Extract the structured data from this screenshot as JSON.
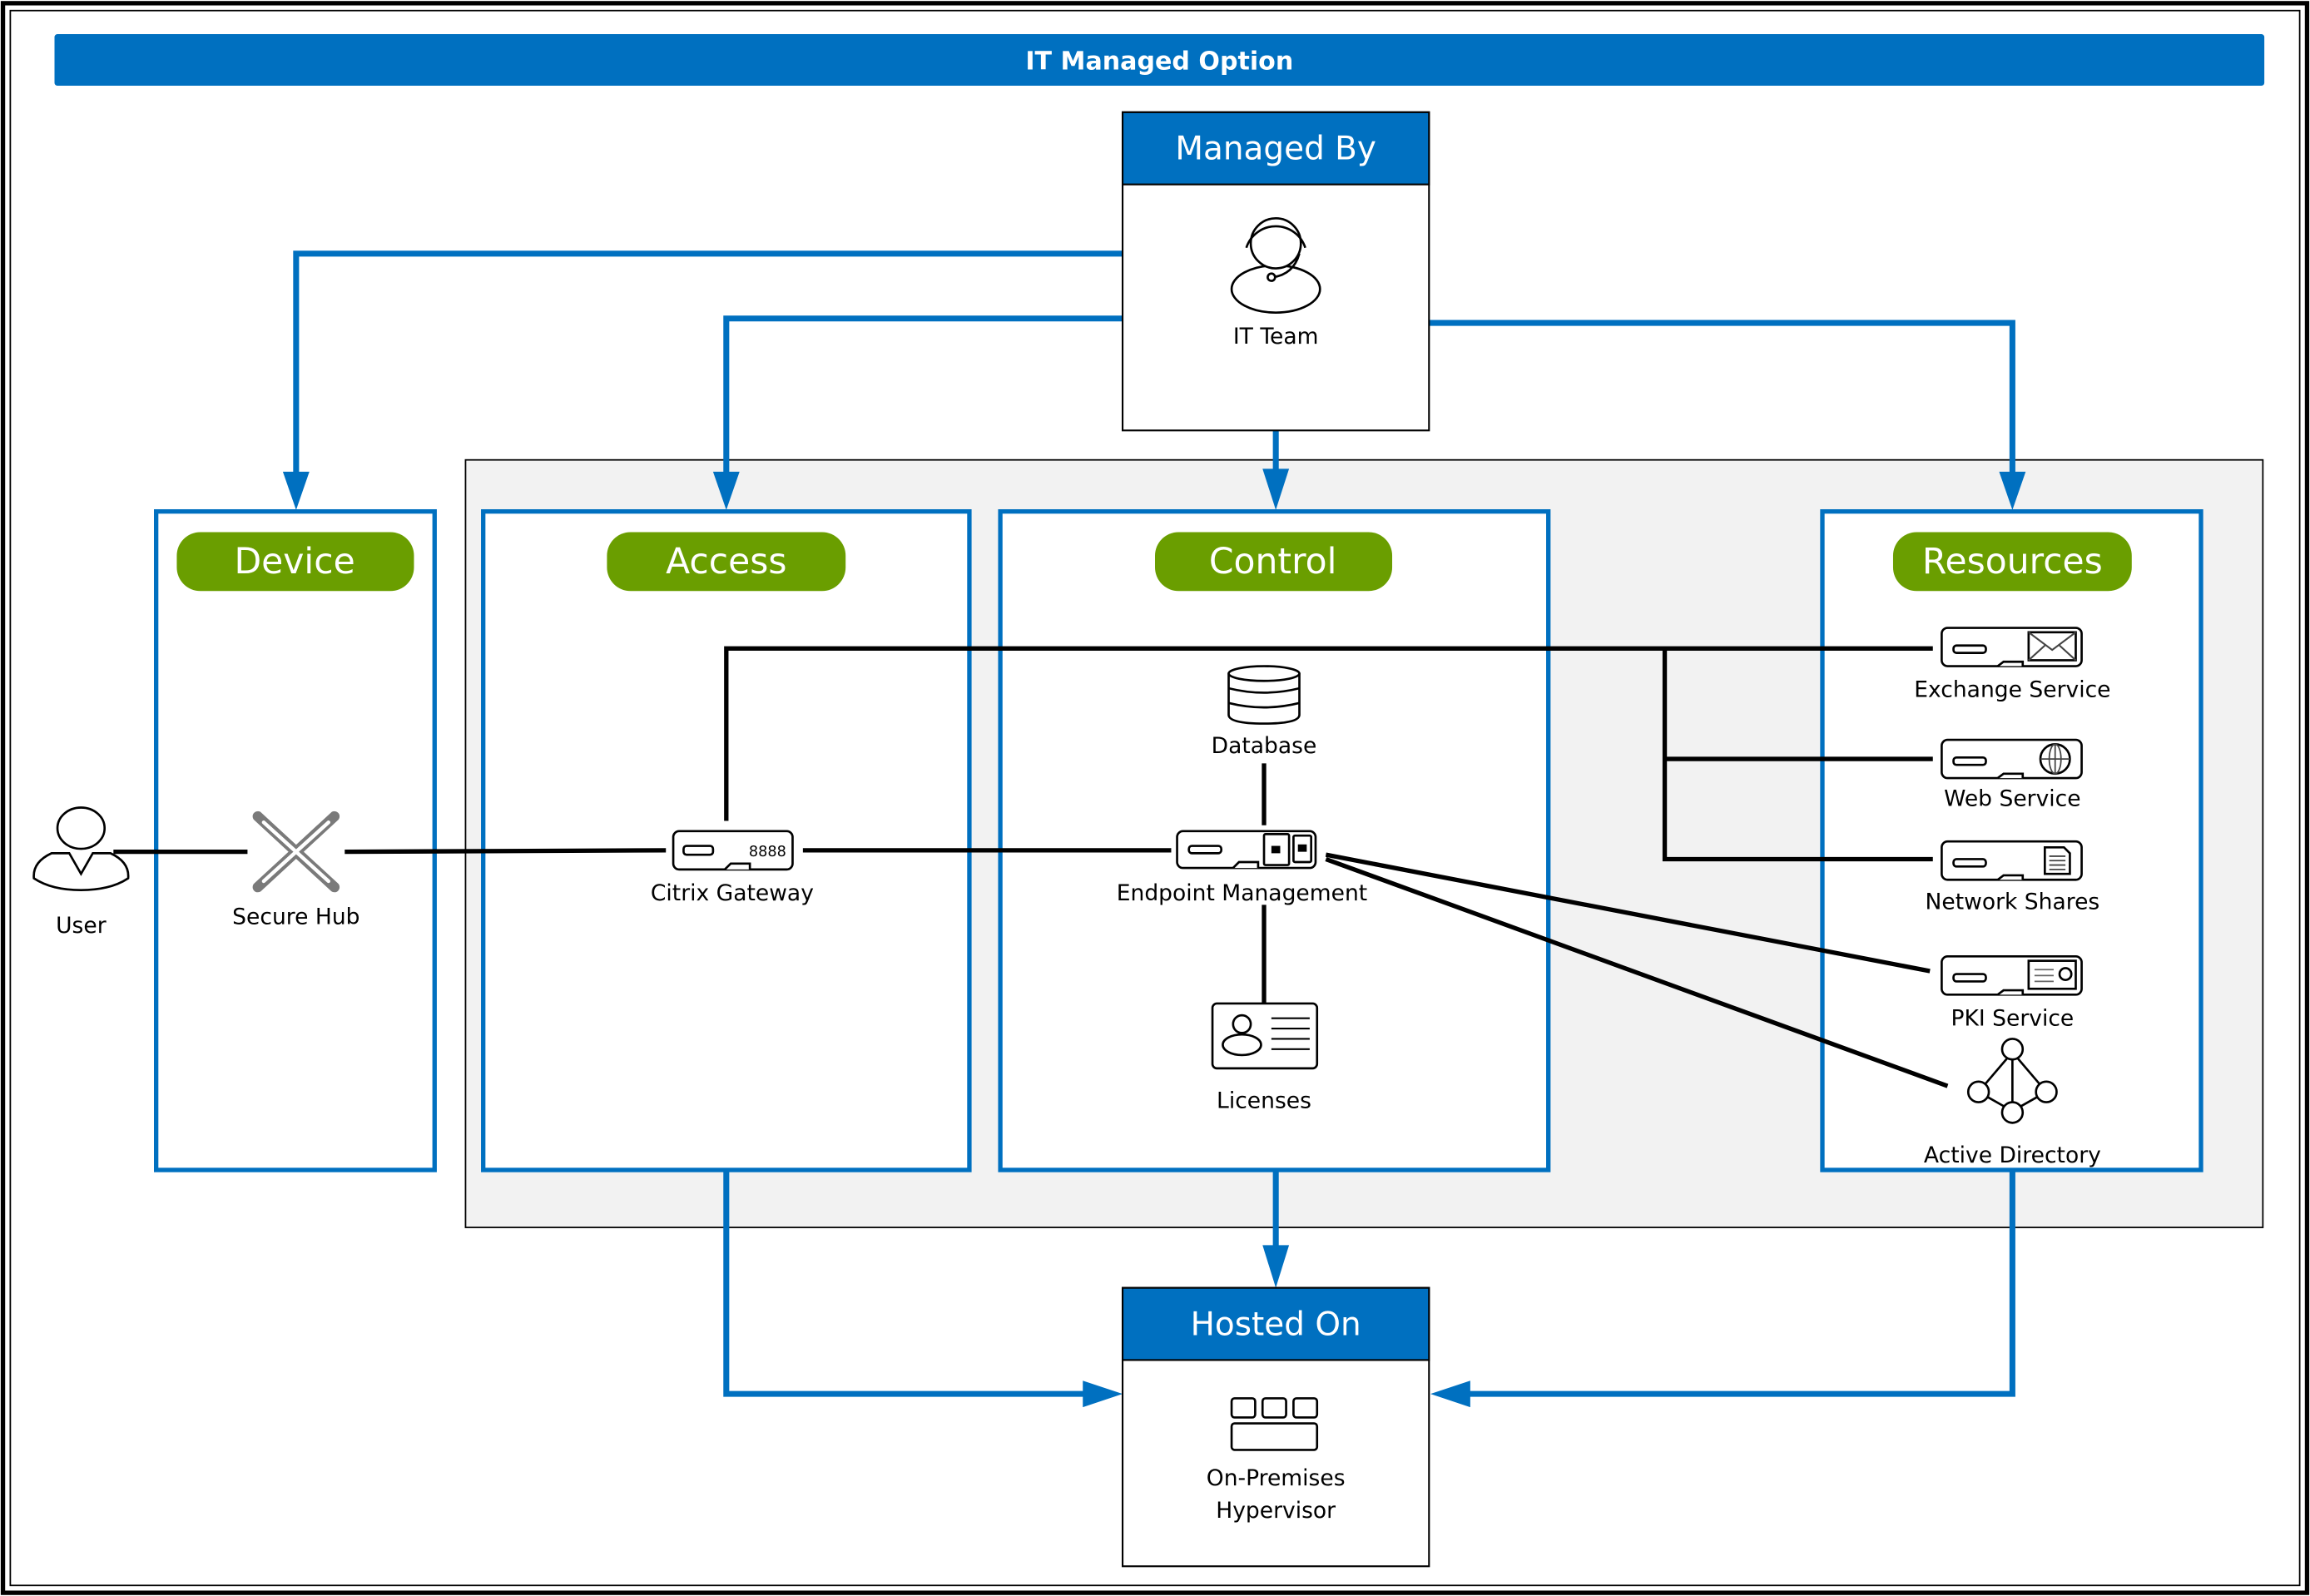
{
  "title": "IT Managed Option",
  "colors": {
    "brand_blue": "#0070C0",
    "pill_green": "#6A9E00",
    "panel_gray": "#F2F2F2",
    "line_black": "#000000",
    "hub_gray": "#7A7A7A"
  },
  "managed_by": {
    "header": "Managed By",
    "item": {
      "label": "IT Team",
      "icon": "headset-user-icon"
    }
  },
  "hosted_on": {
    "header": "Hosted On",
    "item": {
      "label_line1": "On-Premises",
      "label_line2": "Hypervisor",
      "icon": "hypervisor-icon"
    }
  },
  "user": {
    "label": "User",
    "icon": "user-icon"
  },
  "sections": {
    "device": {
      "label": "Device",
      "items": [
        {
          "label": "Secure Hub",
          "icon": "secure-hub-icon"
        }
      ]
    },
    "access": {
      "label": "Access",
      "items": [
        {
          "label": "Citrix Gateway",
          "icon": "gateway-appliance-icon"
        }
      ]
    },
    "control": {
      "label": "Control",
      "items": [
        {
          "label": "Database",
          "icon": "database-icon"
        },
        {
          "label": "Endpoint Management",
          "icon": "endpoint-appliance-icon"
        },
        {
          "label": "Licenses",
          "icon": "license-card-icon"
        }
      ]
    },
    "resources": {
      "label": "Resources",
      "items": [
        {
          "label": "Exchange Service",
          "icon": "mail-server-icon"
        },
        {
          "label": "Web Service",
          "icon": "globe-server-icon"
        },
        {
          "label": "Network Shares",
          "icon": "document-server-icon"
        },
        {
          "label": "PKI Service",
          "icon": "certificate-server-icon"
        },
        {
          "label": "Active Directory",
          "icon": "directory-network-icon"
        }
      ]
    }
  }
}
